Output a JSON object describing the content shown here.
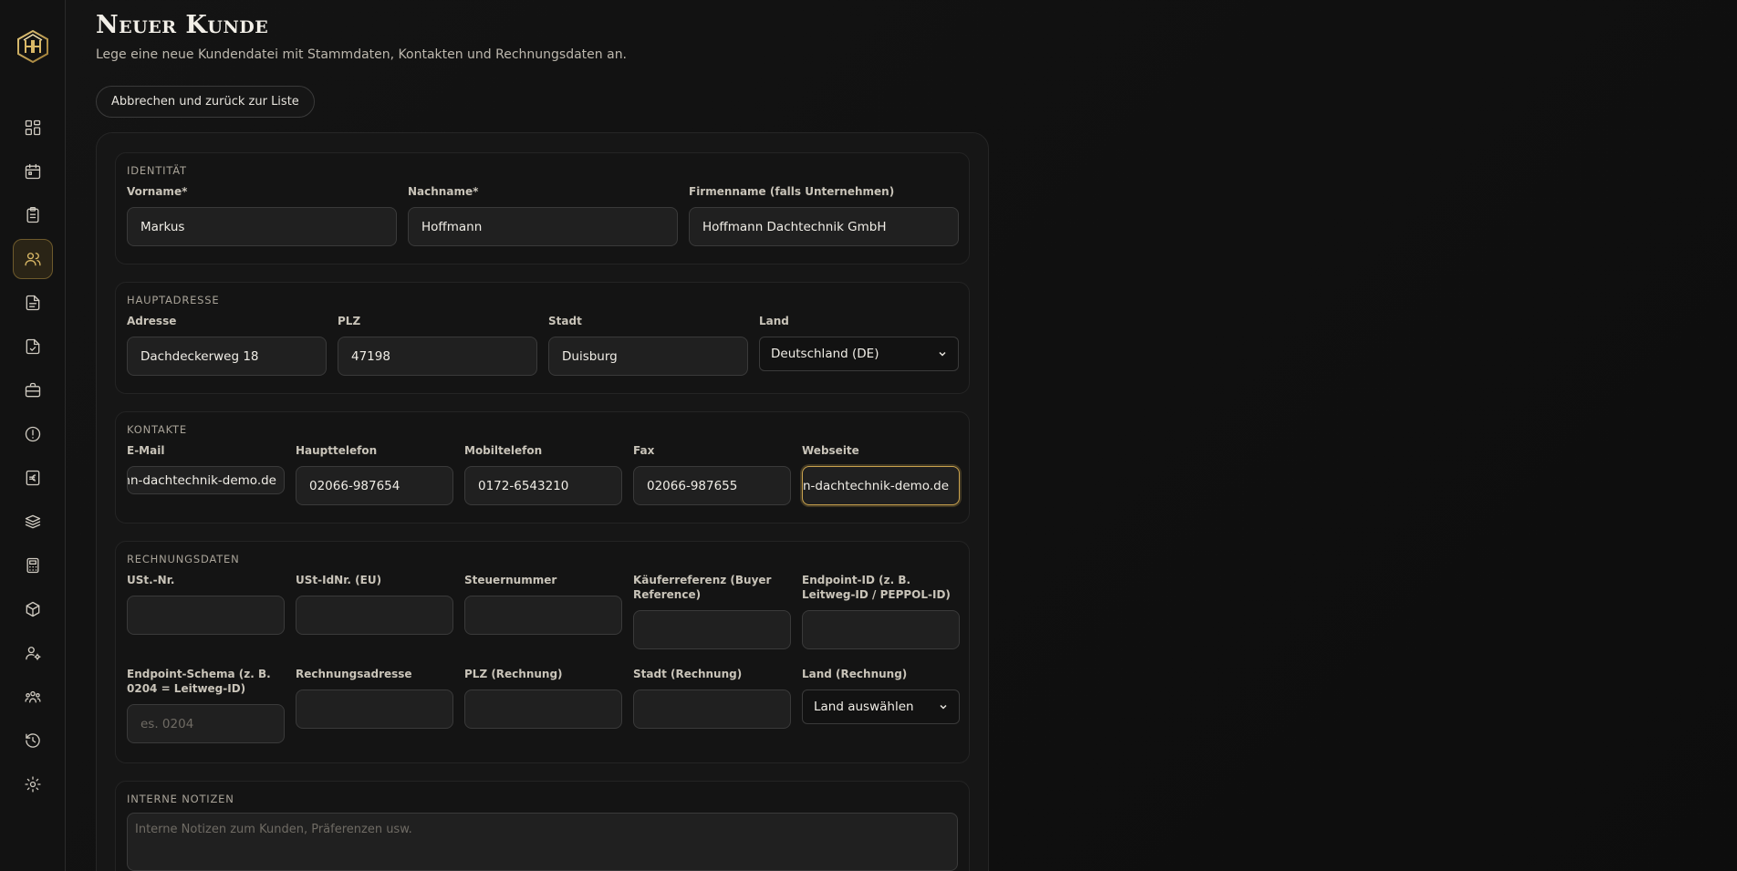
{
  "sidebar": {
    "items": [
      {
        "icon": "dashboard-icon"
      },
      {
        "icon": "calendar-icon"
      },
      {
        "icon": "clipboard-icon"
      },
      {
        "icon": "users-icon",
        "active": true
      },
      {
        "icon": "document-icon"
      },
      {
        "icon": "document-check-icon"
      },
      {
        "icon": "briefcase-icon"
      },
      {
        "icon": "alert-circle-icon"
      },
      {
        "icon": "euro-receipt-icon"
      },
      {
        "icon": "stack-icon"
      },
      {
        "icon": "calculator-icon"
      },
      {
        "icon": "package-icon"
      },
      {
        "icon": "user-settings-icon"
      },
      {
        "icon": "team-icon"
      },
      {
        "icon": "history-icon"
      },
      {
        "icon": "settings-icon"
      }
    ],
    "accent_color": "#d9b866"
  },
  "header": {
    "title": "Neuer Kunde",
    "subtitle": "Lege eine neue Kundendatei mit Stammdaten, Kontakten und Rechnungsdaten an.",
    "back_label": "Abbrechen und zurück zur Liste"
  },
  "identity": {
    "title": "Identität",
    "first_name_label": "Vorname*",
    "first_name_value": "Markus",
    "last_name_label": "Nachname*",
    "last_name_value": "Hoffmann",
    "company_label": "Firmenname (falls Unternehmen)",
    "company_value": "Hoffmann Dachtechnik GmbH"
  },
  "address": {
    "title": "Hauptadresse",
    "street_label": "Adresse",
    "street_value": "Dachdeckerweg 18",
    "zip_label": "PLZ",
    "zip_value": "47198",
    "city_label": "Stadt",
    "city_value": "Duisburg",
    "country_label": "Land",
    "country_value": "Deutschland (DE)"
  },
  "contacts": {
    "title": "Kontakte",
    "email_label": "E-Mail",
    "email_value": "ıann-dachtechnik-demo.de",
    "phone_label": "Haupttelefon",
    "phone_value": "02066-987654",
    "mobile_label": "Mobiltelefon",
    "mobile_value": "0172-6543210",
    "fax_label": "Fax",
    "fax_value": "02066-987655",
    "website_label": "Webseite",
    "website_value": "nn-dachtechnik-demo.de"
  },
  "billing": {
    "title": "Rechnungsdaten",
    "vat_label": "USt.-Nr.",
    "vat_value": "",
    "vat_id_label": "USt-IdNr. (EU)",
    "vat_id_value": "",
    "tax_no_label": "Steuernummer",
    "tax_no_value": "",
    "buyer_ref_label": "Käuferreferenz (Buyer Reference)",
    "buyer_ref_value": "",
    "endpoint_id_label": "Endpoint-ID (z. B. Leitweg-ID / PEPPOL-ID)",
    "endpoint_id_value": "",
    "endpoint_schema_label": "Endpoint-Schema (z. B. 0204 = Leitweg-ID)",
    "endpoint_schema_placeholder": "es. 0204",
    "billing_address_label": "Rechnungsadresse",
    "billing_address_value": "",
    "billing_zip_label": "PLZ (Rechnung)",
    "billing_zip_value": "",
    "billing_city_label": "Stadt (Rechnung)",
    "billing_city_value": "",
    "billing_country_label": "Land (Rechnung)",
    "billing_country_value": "Land auswählen"
  },
  "notes": {
    "title": "Interne Notizen",
    "placeholder": "Interne Notizen zum Kunden, Präferenzen usw."
  }
}
